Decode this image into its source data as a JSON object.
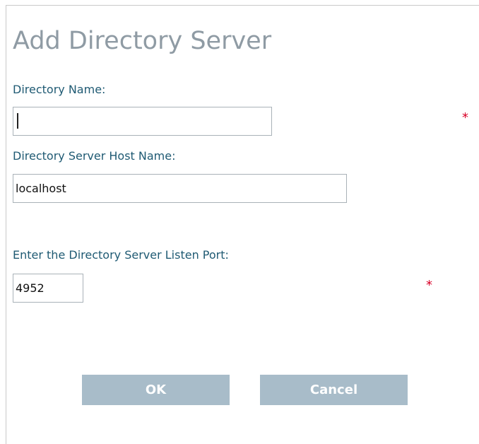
{
  "dialog": {
    "title": "Add Directory Server"
  },
  "fields": {
    "directory_name": {
      "label": "Directory Name:",
      "value": "",
      "required_marker": "*"
    },
    "host_name": {
      "label": "Directory Server Host Name:",
      "value": "localhost"
    },
    "listen_port": {
      "label": "Enter the Directory Server Listen Port:",
      "value": "4952",
      "required_marker": "*"
    }
  },
  "buttons": {
    "ok_label": "OK",
    "cancel_label": "Cancel"
  },
  "colors": {
    "title": "#8f9ba4",
    "label": "#1f5a73",
    "required": "#d80027",
    "button_bg": "#a8bcc9",
    "button_text": "#ffffff"
  }
}
